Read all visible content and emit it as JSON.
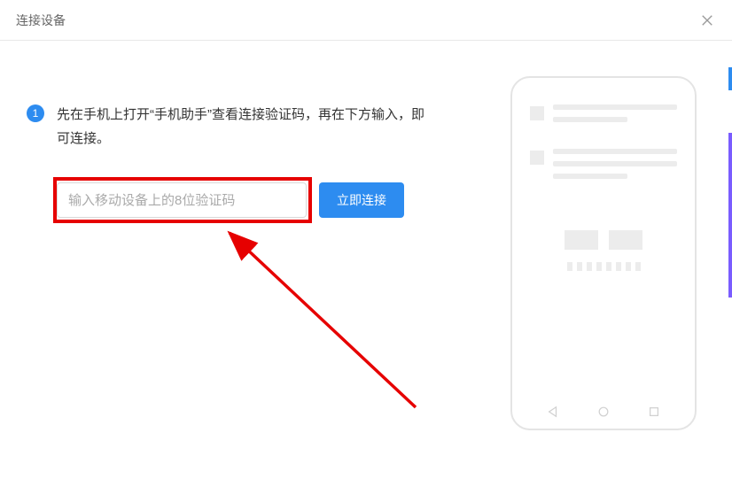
{
  "header": {
    "title": "连接设备"
  },
  "step": {
    "number": "1",
    "text": "先在手机上打开“手机助手”查看连接验证码，再在下方输入，即可连接。"
  },
  "input": {
    "placeholder": "输入移动设备上的8位验证码",
    "value": ""
  },
  "button": {
    "connect": "立即连接"
  }
}
